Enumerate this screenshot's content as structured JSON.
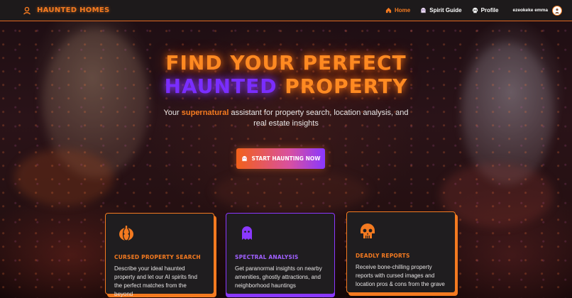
{
  "brand": {
    "name": "HAUNTED HOMES",
    "icon": "ghost-person-icon"
  },
  "nav": {
    "items": [
      {
        "label": "Home",
        "icon": "home-icon",
        "active": true
      },
      {
        "label": "Spirit Guide",
        "icon": "ghost-icon",
        "active": false
      },
      {
        "label": "Profile",
        "icon": "skull-icon",
        "active": false
      }
    ],
    "user_name": "ezeokeke emma"
  },
  "hero": {
    "title_line1": "FIND YOUR PERFECT",
    "title_line2_a": "HAUNTED",
    "title_line2_b": " PROPERTY",
    "subtitle_a": "Your ",
    "subtitle_highlight": "supernatural",
    "subtitle_b": " assistant for property search, location analysis, and real estate insights",
    "cta_label": "START HAUNTING NOW"
  },
  "features": [
    {
      "title": "CURSED PROPERTY SEARCH",
      "description": "Describe your ideal haunted property and let our AI spirits find the perfect matches from the beyond",
      "icon": "pumpkin-icon"
    },
    {
      "title": "SPECTRAL ANALYSIS",
      "description": "Get paranormal insights on nearby amenities, ghostly attractions, and neighborhood hauntings",
      "icon": "ghost-icon"
    },
    {
      "title": "DEADLY REPORTS",
      "description": "Receive bone-chilling property reports with cursed images and location pros & cons from the grave",
      "icon": "skull-icon"
    }
  ],
  "colors": {
    "accent": "#f47a20",
    "purple": "#8a38ff",
    "header_bg": "#1d1a1b",
    "card_bg": "#1f1d1f"
  }
}
